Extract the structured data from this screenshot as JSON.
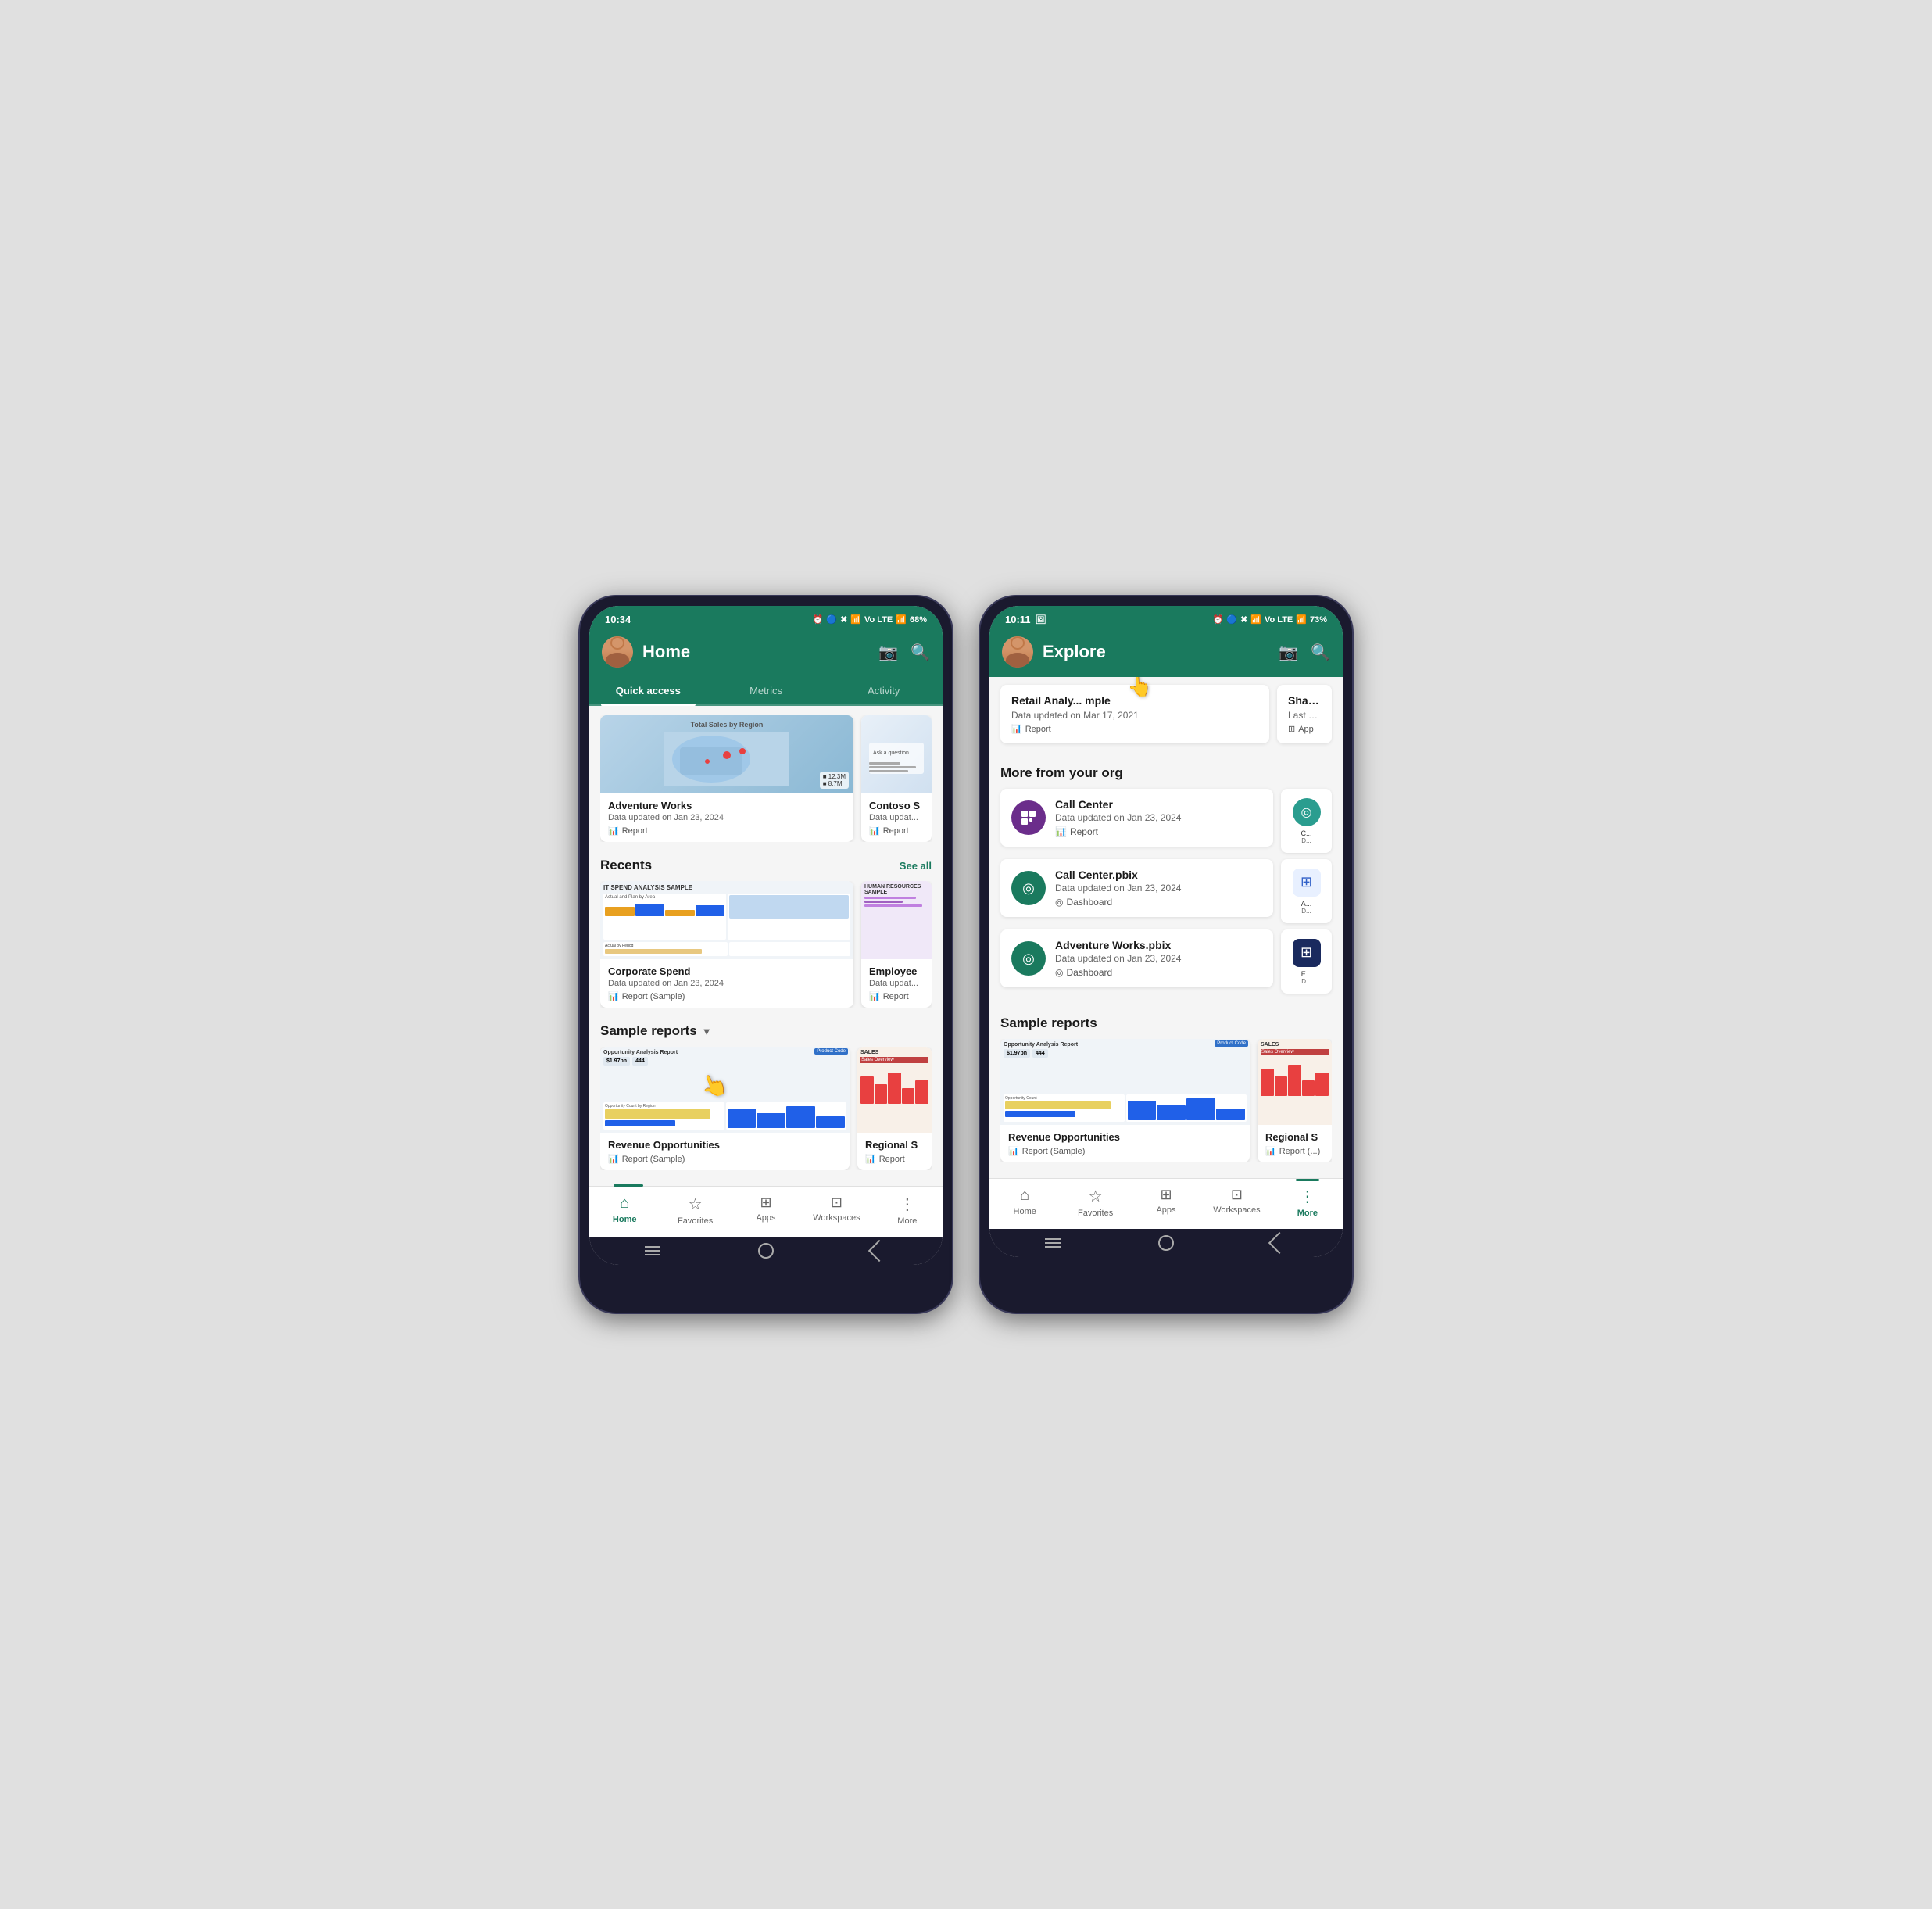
{
  "phone1": {
    "status": {
      "time": "10:34",
      "battery": "68%",
      "signal": "Vo LTE"
    },
    "header": {
      "title": "Home",
      "camera_label": "📷",
      "search_label": "🔍"
    },
    "tabs": [
      {
        "label": "Quick access",
        "active": true
      },
      {
        "label": "Metrics",
        "active": false
      },
      {
        "label": "Activity",
        "active": false
      }
    ],
    "quick_access_cards": [
      {
        "title": "Adventure Works",
        "subtitle": "Data updated on Jan 23, 2024",
        "type": "Report"
      },
      {
        "title": "Contoso S",
        "subtitle": "Data updat...",
        "type": "Report"
      }
    ],
    "recents": {
      "title": "Recents",
      "see_all": "See all",
      "cards": [
        {
          "title": "Corporate Spend",
          "subtitle": "Data updated on Jan 23, 2024",
          "type": "Report (Sample)"
        },
        {
          "title": "Employee",
          "subtitle": "Data updat...",
          "type": "Report"
        }
      ]
    },
    "sample_reports": {
      "title": "Sample reports",
      "cards": [
        {
          "title": "Revenue Opportunities",
          "subtitle": "",
          "type": "Report (Sample)"
        },
        {
          "title": "Regional S",
          "subtitle": "",
          "type": "Report"
        }
      ]
    },
    "bottom_nav": [
      {
        "label": "Home",
        "icon": "🏠",
        "active": true
      },
      {
        "label": "Favorites",
        "icon": "☆",
        "active": false
      },
      {
        "label": "Apps",
        "icon": "⊞",
        "active": false
      },
      {
        "label": "Workspaces",
        "icon": "⊡",
        "active": false
      },
      {
        "label": "More",
        "icon": "⋮",
        "active": false
      }
    ]
  },
  "phone2": {
    "status": {
      "time": "10:11",
      "battery": "73%",
      "signal": "Vo LTE"
    },
    "header": {
      "title": "Explore",
      "camera_label": "📷",
      "search_label": "🔍"
    },
    "top_cards": [
      {
        "title": "Retail Analy... mple",
        "subtitle": "Data updated on Mar 17, 2021",
        "type": "Report"
      },
      {
        "title": "Sharing ap...",
        "subtitle": "Last publi...",
        "type": "App"
      }
    ],
    "more_from_org": {
      "title": "More from your org",
      "items": [
        {
          "title": "Call Center",
          "subtitle": "Data updated on Jan 23, 2024",
          "type": "Report",
          "icon_bg": "#6b2d8b",
          "icon": "📊"
        },
        {
          "title": "Call Center.pbix",
          "subtitle": "Data updated on Jan 23, 2024",
          "type": "Dashboard",
          "icon_bg": "#1a7a5e",
          "icon": "◎"
        },
        {
          "title": "Adventure Works.pbix",
          "subtitle": "Data updated on Jan 23, 2024",
          "type": "Dashboard",
          "icon_bg": "#1a7a5e",
          "icon": "◎"
        }
      ],
      "right_items": [
        {
          "title": "C...",
          "subtitle": "D...",
          "type": "",
          "icon_bg": "#2a9d8f",
          "icon": "◎"
        },
        {
          "title": "A...",
          "subtitle": "D...",
          "type": "",
          "icon_bg": "#f0f4ff",
          "icon": "⊞"
        },
        {
          "title": "E...",
          "subtitle": "D...",
          "type": "",
          "icon_bg": "#1a2a5e",
          "icon": "⊞"
        }
      ]
    },
    "sample_reports": {
      "title": "Sample reports",
      "cards": [
        {
          "title": "Revenue Opportunities",
          "subtitle": "",
          "type": "Report (Sample)"
        },
        {
          "title": "Regional S",
          "subtitle": "",
          "type": "Report (...)"
        }
      ]
    },
    "bottom_nav": [
      {
        "label": "Home",
        "icon": "🏠",
        "active": false
      },
      {
        "label": "Favorites",
        "icon": "☆",
        "active": false
      },
      {
        "label": "Apps",
        "icon": "⊞",
        "active": false
      },
      {
        "label": "Workspaces",
        "icon": "⊡",
        "active": false
      },
      {
        "label": "More",
        "icon": "⋮",
        "active": true
      }
    ]
  },
  "icons": {
    "report": "📊",
    "dashboard": "◎",
    "app": "⊞",
    "camera": "📷",
    "search": "🔍",
    "home": "⌂",
    "star": "☆",
    "grid": "⊞",
    "workspace": "⊡",
    "more": "⋮",
    "chevron": "▼"
  }
}
